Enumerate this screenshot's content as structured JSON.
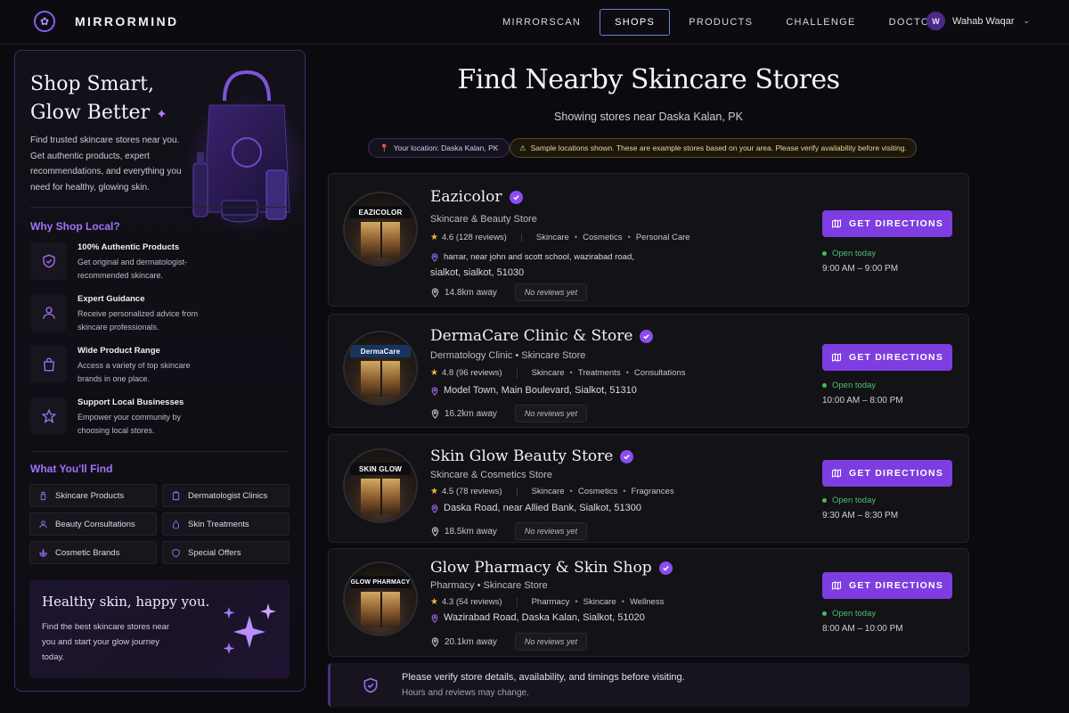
{
  "nav": {
    "brand": "MIRRORMIND",
    "links": [
      "MIRRORSCAN",
      "SHOPS",
      "PRODUCTS",
      "CHALLENGE",
      "DOCTORS"
    ],
    "active": "SHOPS",
    "user_initial": "W",
    "user_name": "Wahab Waqar"
  },
  "sidebar": {
    "hero_title_1": "Shop Smart,",
    "hero_title_2": "Glow Better",
    "hero_desc": "Find trusted skincare stores near you. Get authentic products, expert recommendations, and everything you need for healthy, glowing skin.",
    "why_title": "Why Shop Local?",
    "features": [
      {
        "title": "100% Authentic Products",
        "desc": "Get original and dermatologist-recommended skincare.",
        "icon": "shield-check-icon"
      },
      {
        "title": "Expert Guidance",
        "desc": "Receive personalized advice from skincare professionals.",
        "icon": "person-icon"
      },
      {
        "title": "Wide Product Range",
        "desc": "Access a variety of top skincare brands in one place.",
        "icon": "shopping-bag-icon"
      },
      {
        "title": "Support Local Businesses",
        "desc": "Empower your community by choosing local stores.",
        "icon": "star-icon"
      }
    ],
    "find_title": "What You'll Find",
    "chips": [
      {
        "label": "Skincare Products",
        "icon": "bottle-icon"
      },
      {
        "label": "Dermatologist Clinics",
        "icon": "clipboard-icon"
      },
      {
        "label": "Beauty Consultations",
        "icon": "person-icon"
      },
      {
        "label": "Skin Treatments",
        "icon": "drop-icon"
      },
      {
        "label": "Cosmetic Brands",
        "icon": "lotus-icon"
      },
      {
        "label": "Special Offers",
        "icon": "badge-icon"
      }
    ],
    "promo_title": "Healthy skin, happy you.",
    "promo_desc": "Find the best skincare stores near you and start your glow journey today."
  },
  "main": {
    "title": "Find Nearby Skincare Stores",
    "subtitle": "Showing stores near Daska Kalan, PK",
    "location_pill": "Your location: Daska Kalan, PK",
    "warning_pill": "Sample locations shown. These are example stores based on your area. Please verify availability before visiting.",
    "directions_label": "GET DIRECTIONS",
    "no_reviews_label": "No reviews yet",
    "open_label": "Open today",
    "stores": [
      {
        "name": "Eazicolor",
        "sign": "EAZICOLOR",
        "type": "Skincare & Beauty Store",
        "rating": "4.6",
        "reviews": "(128 reviews)",
        "tags": [
          "Skincare",
          "Cosmetics",
          "Personal Care"
        ],
        "address": "harrar, near john and scott school, wazirabad road,",
        "address2": "sialkot, sialkot, 51030",
        "distance": "14.8km away",
        "hours": "9:00 AM – 9:00 PM"
      },
      {
        "name": "DermaCare Clinic & Store",
        "sign": "DermaCare",
        "type": "Dermatology Clinic • Skincare Store",
        "rating": "4.8",
        "reviews": "(96 reviews)",
        "tags": [
          "Skincare",
          "Treatments",
          "Consultations"
        ],
        "address": "Model Town, Main Boulevard, Sialkot, 51310",
        "distance": "16.2km away",
        "hours": "10:00 AM – 8:00 PM"
      },
      {
        "name": "Skin Glow Beauty Store",
        "sign": "SKIN GLOW",
        "type": "Skincare & Cosmetics Store",
        "rating": "4.5",
        "reviews": "(78 reviews)",
        "tags": [
          "Skincare",
          "Cosmetics",
          "Fragrances"
        ],
        "address": "Daska Road, near Allied Bank, Sialkot, 51300",
        "distance": "18.5km away",
        "hours": "9:30 AM – 8:30 PM"
      },
      {
        "name": "Glow Pharmacy & Skin Shop",
        "sign": "GLOW PHARMACY",
        "type": "Pharmacy • Skincare Store",
        "rating": "4.3",
        "reviews": "(54 reviews)",
        "tags": [
          "Pharmacy",
          "Skincare",
          "Wellness"
        ],
        "address": "Wazirabad Road, Daska Kalan, Sialkot, 51020",
        "distance": "20.1km away",
        "hours": "8:00 AM – 10:00 PM"
      }
    ],
    "notice_line1": "Please verify store details, availability, and timings before visiting.",
    "notice_line2": "Hours and reviews may change."
  },
  "colors": {
    "accent": "#7e3de0",
    "accent_text": "#a371f7",
    "open_green": "#4fbf6a",
    "star": "#f5b53d"
  }
}
